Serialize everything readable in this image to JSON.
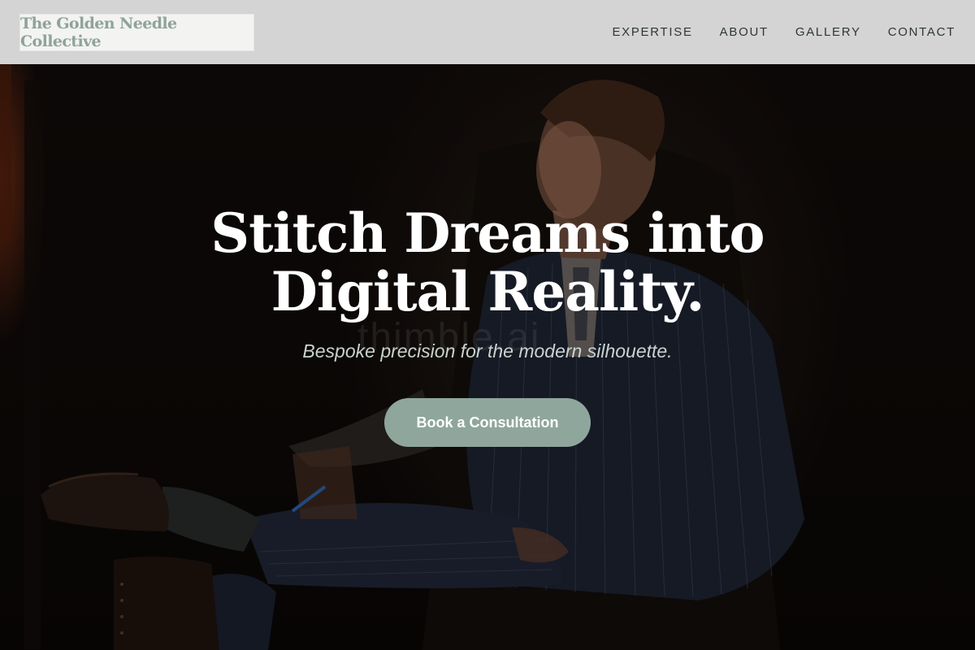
{
  "header": {
    "logo_text": "The Golden Needle Collective",
    "nav": [
      {
        "label": "EXPERTISE"
      },
      {
        "label": "ABOUT"
      },
      {
        "label": "GALLERY"
      },
      {
        "label": "CONTACT"
      }
    ]
  },
  "hero": {
    "title_line1": "Stitch Dreams into",
    "title_line2": "Digital Reality.",
    "subtitle": "Bespoke precision for the modern silhouette.",
    "watermark": "thimble.ai",
    "cta_label": "Book a Consultation",
    "background_image": "man-in-pinstripe-suit-seated-in-dark-room"
  },
  "colors": {
    "header_bg": "#d4d4d4",
    "logo_text": "#8fa39a",
    "accent_button": "#8fa69d",
    "hero_bg": "#0b0706"
  }
}
